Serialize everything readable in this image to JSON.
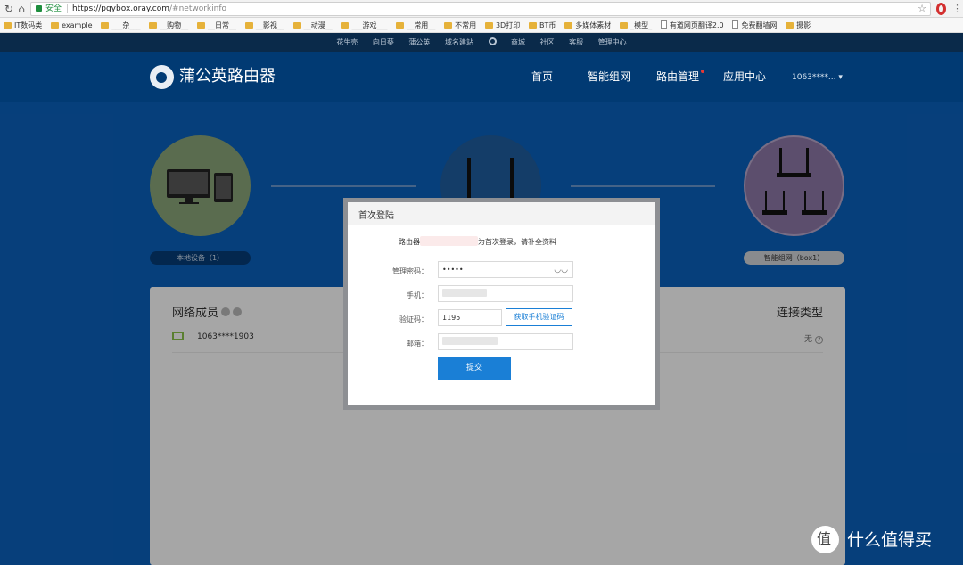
{
  "browser": {
    "back_icon": "reload-icon",
    "home_icon": "home-icon",
    "secure_label": "安全",
    "url_host": "https://pgybox.oray.com",
    "url_path": "/#networkinfo",
    "bookmarks": [
      "IT数码类",
      "example",
      "___杂___",
      "__购物__",
      "__日常__",
      "__影视__",
      "__动漫__",
      "___游戏___",
      "__常用__",
      "不常用",
      "3D打印",
      "BT币",
      "多媒体素材",
      "_模型_",
      "有道网页翻译2.0",
      "免费翻墙网",
      "摄影"
    ]
  },
  "topbar": {
    "links": [
      "花生壳",
      "向日葵",
      "蒲公英",
      "域名建站",
      "商城",
      "社区",
      "客服",
      "管理中心"
    ]
  },
  "header": {
    "logo": "蒲公英路由器",
    "nav": [
      "首页",
      "智能组网",
      "路由管理",
      "应用中心"
    ],
    "user": "1063****..."
  },
  "topology": {
    "local_devices": "本地设备（1）",
    "network_group": "智能组网（box1）"
  },
  "panel": {
    "title": "网络成员",
    "connection_type": "连接类型",
    "member_id": "1063****1903",
    "member_conn": "无"
  },
  "modal": {
    "title": "首次登陆",
    "notice_prefix": "路由器",
    "notice_suffix": "为首次登录，请补全资料",
    "password_label": "管理密码：",
    "password_value": "•••••",
    "phone_label": "手机：",
    "code_label": "验证码：",
    "code_value": "1195",
    "get_code_button": "获取手机验证码",
    "email_label": "邮箱：",
    "submit_button": "提交"
  },
  "watermark": {
    "text": "什么值得买"
  }
}
